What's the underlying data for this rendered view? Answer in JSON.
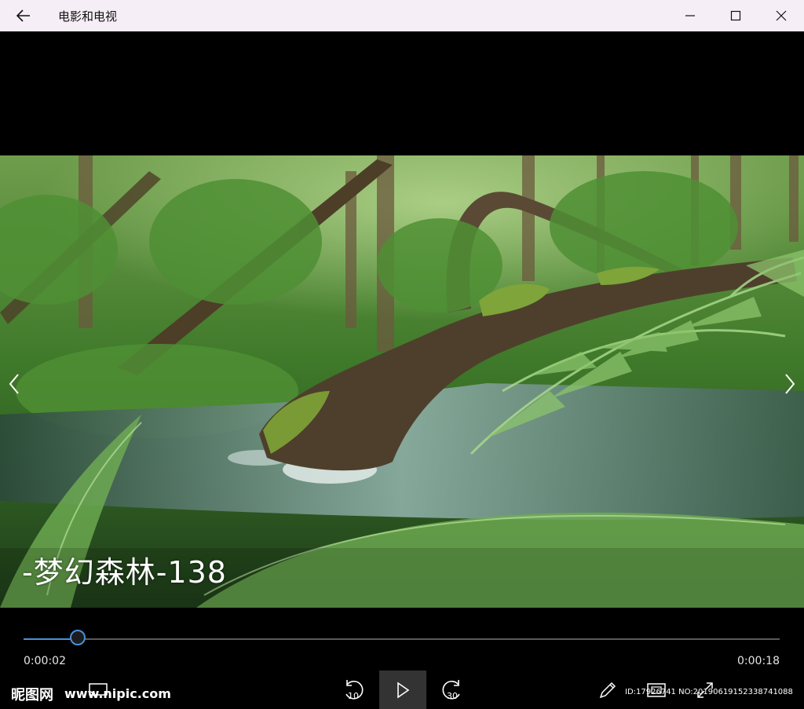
{
  "app": {
    "title": "电影和电视"
  },
  "video": {
    "subtitle": "-梦幻森林-138",
    "progress": 0.072
  },
  "player": {
    "current_time": "0:00:02",
    "total_time": "0:00:18",
    "skip_back_seconds": "10",
    "skip_forward_seconds": "30"
  },
  "watermarks": {
    "logo_text": "昵图网",
    "site": "www.nipic.com",
    "id_text": "ID:17926741 NO:20190619152338741088"
  },
  "colors": {
    "titlebar_bg": "#f5eef6",
    "accent": "#4a90d9",
    "background": "#000000"
  },
  "icons": [
    "back-arrow-icon",
    "minimize-icon",
    "maximize-icon",
    "close-icon",
    "chevron-left-icon",
    "chevron-right-icon",
    "skip-back-icon",
    "play-icon",
    "skip-forward-icon",
    "pen-icon",
    "aspect-ratio-icon",
    "fullscreen-icon",
    "cast-icon"
  ]
}
